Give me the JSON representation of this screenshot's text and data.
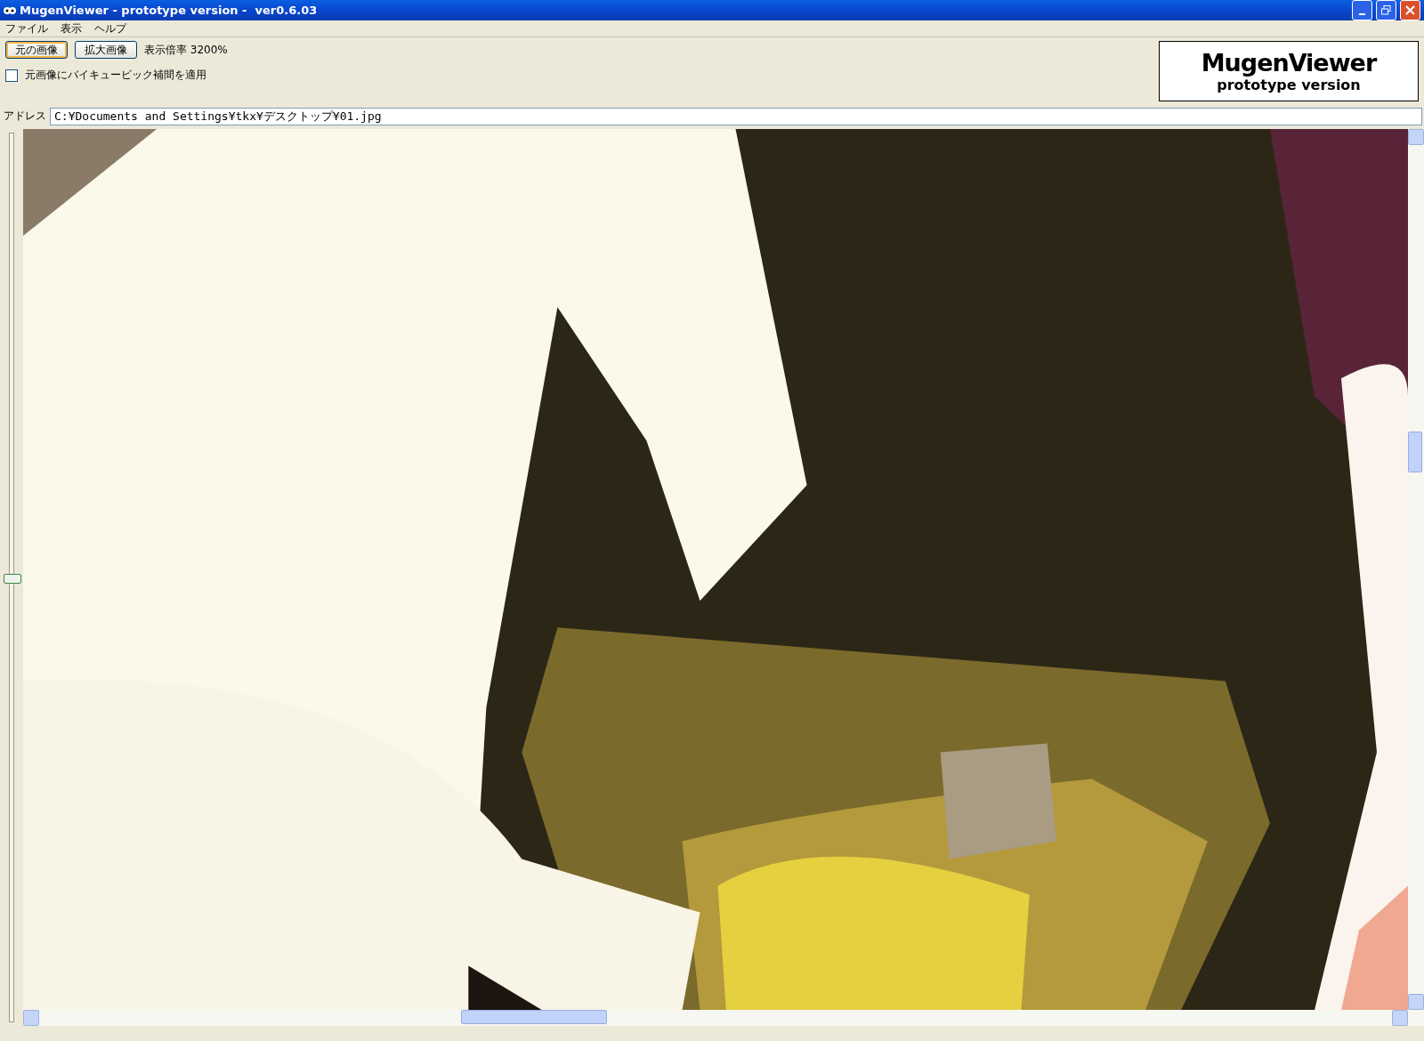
{
  "window": {
    "title": "MugenViewer - prototype version -  ver0.6.03"
  },
  "menu": [
    "ファイル",
    "表示",
    "ヘルプ"
  ],
  "toolbar": {
    "buttons": [
      {
        "label": "元の画像",
        "selected": true
      },
      {
        "label": "拡大画像",
        "selected": false
      }
    ],
    "zoom_label": "表示倍率 3200%",
    "bicubic": {
      "label": "元画像にバイキュービック補間を適用",
      "checked": false
    }
  },
  "logo": {
    "title": "MugenViewer",
    "subtitle": "prototype version"
  },
  "address": {
    "label": "アドレス",
    "value": "C:¥Documents and Settings¥tkx¥デスクトップ¥01.jpg"
  },
  "zoom_slider": {
    "level": 0.5
  }
}
